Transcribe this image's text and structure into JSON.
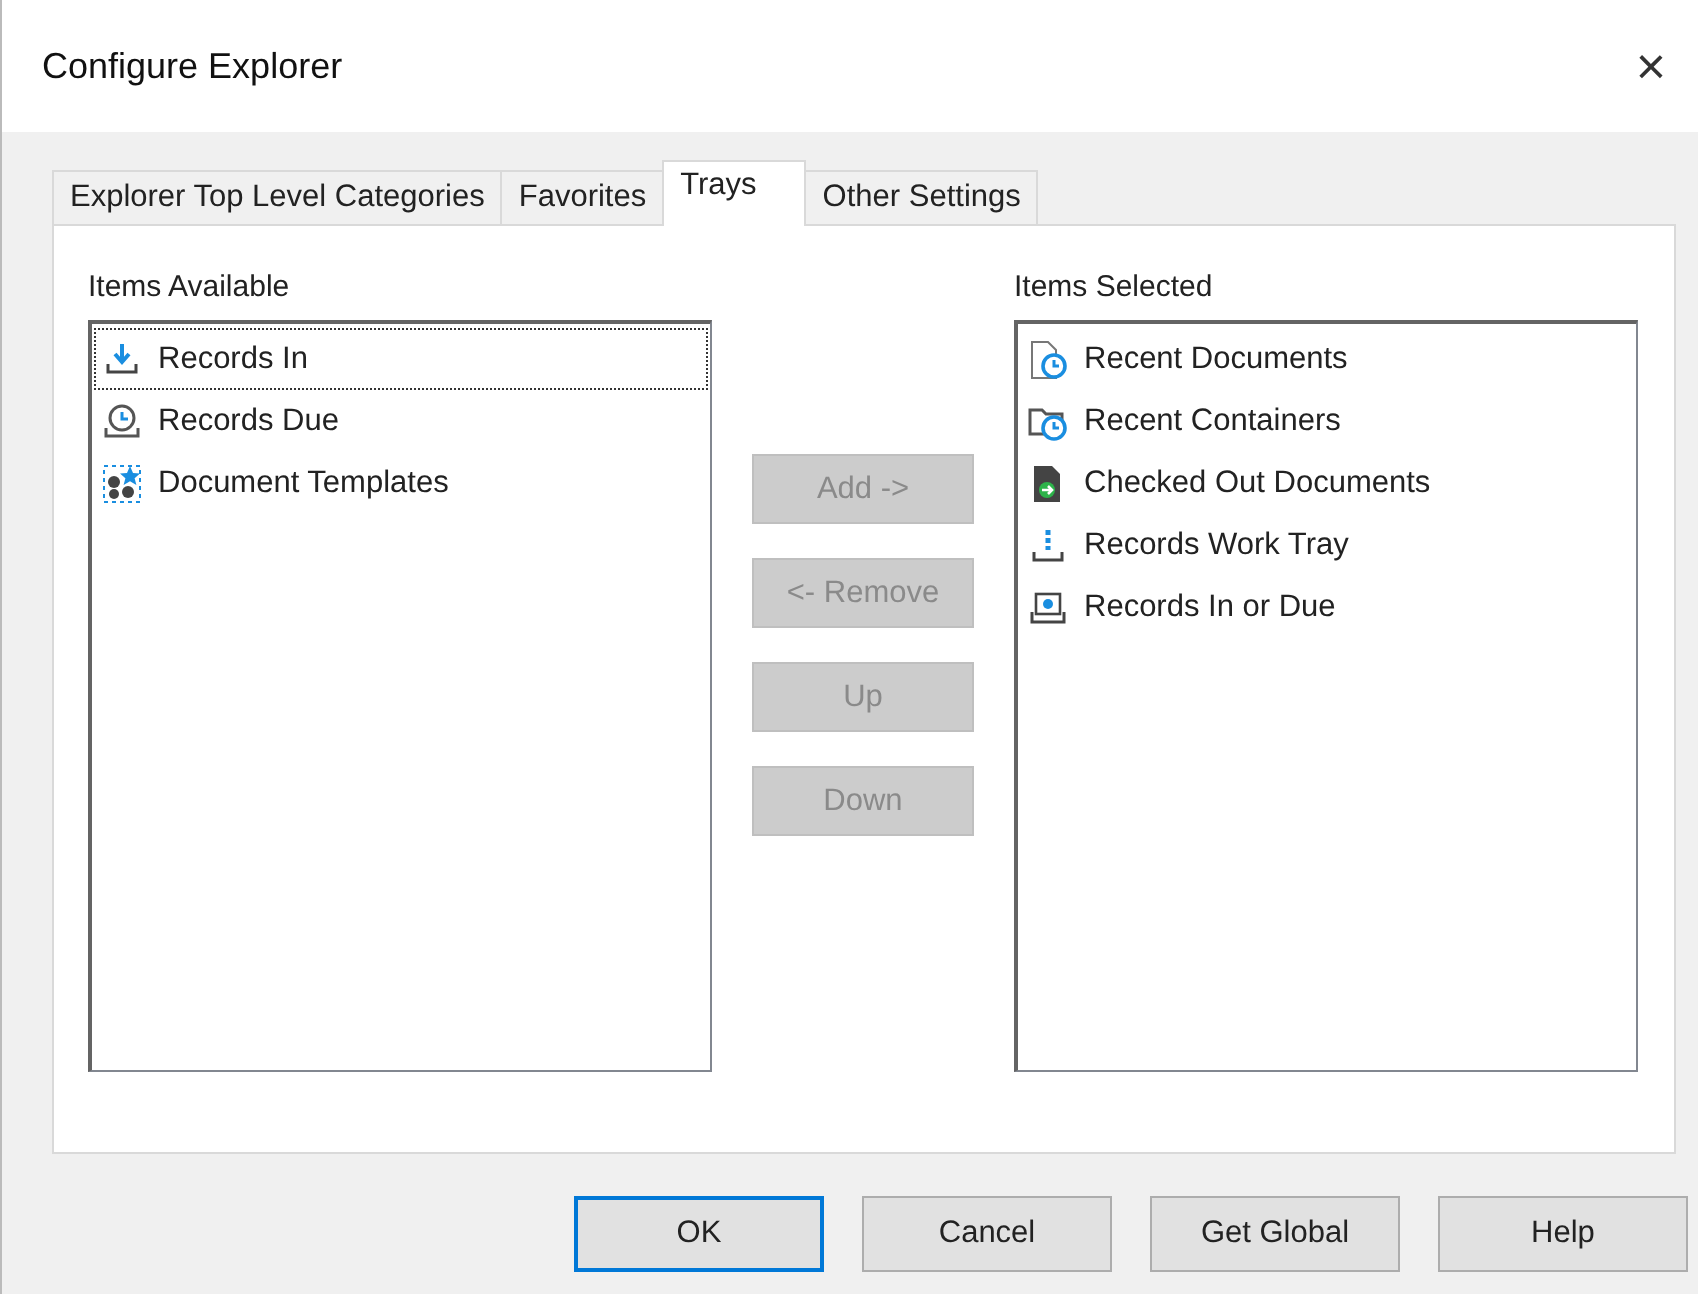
{
  "window": {
    "title": "Configure Explorer",
    "close": "×"
  },
  "tabs": [
    {
      "label": "Explorer Top Level Categories",
      "selected": false
    },
    {
      "label": "Favorites",
      "selected": false
    },
    {
      "label": "Trays",
      "selected": true
    },
    {
      "label": "Other Settings",
      "selected": false
    }
  ],
  "available": {
    "label": "Items Available",
    "items": [
      {
        "label": "Records In",
        "kind": "tray-in",
        "selected": true
      },
      {
        "label": "Records Due",
        "kind": "due",
        "selected": false
      },
      {
        "label": "Document Templates",
        "kind": "templates",
        "selected": false
      }
    ]
  },
  "move_buttons": [
    {
      "label": "Add ->",
      "disabled": true
    },
    {
      "label": "<- Remove",
      "disabled": true
    },
    {
      "label": "Up",
      "disabled": true
    },
    {
      "label": "Down",
      "disabled": true
    }
  ],
  "selected": {
    "label": "Items Selected",
    "items": [
      {
        "label": "Recent Documents",
        "kind": "recent-docs",
        "selected": false
      },
      {
        "label": "Recent Containers",
        "kind": "recent-containers",
        "selected": false
      },
      {
        "label": "Checked Out Documents",
        "kind": "checked-out",
        "selected": false
      },
      {
        "label": "Records Work Tray",
        "kind": "work-tray",
        "selected": false
      },
      {
        "label": "Records In or Due",
        "kind": "in-or-due",
        "selected": false
      }
    ]
  },
  "buttons": [
    {
      "label": "OK",
      "default": true
    },
    {
      "label": "Cancel",
      "default": false
    },
    {
      "label": "Get Global",
      "default": false
    },
    {
      "label": "Help",
      "default": false
    }
  ]
}
